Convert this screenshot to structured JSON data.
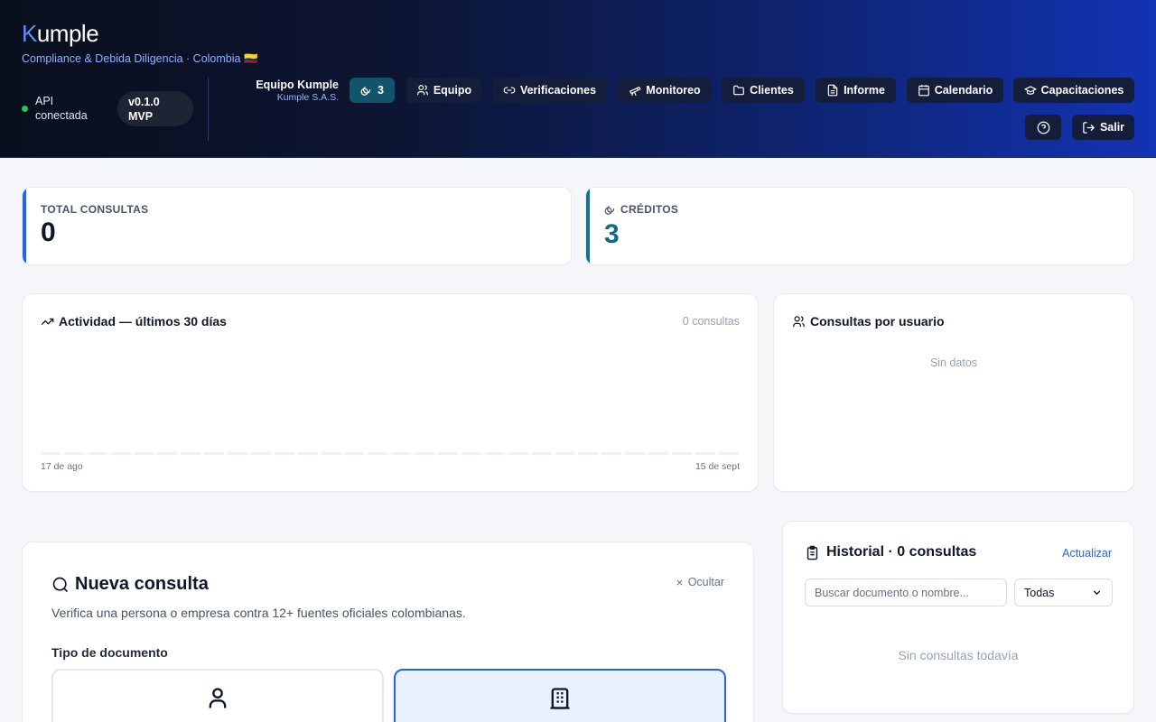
{
  "header": {
    "logo_k": "K",
    "logo_rest": "umple",
    "tagline": "Compliance & Debida Diligencia · Colombia 🇨🇴",
    "api_status": "API conectada",
    "version": "v0.1.0 MVP",
    "team_name": "Equipo Kumple",
    "team_org": "Kumple S.A.S.",
    "credits_count": "3",
    "nav": {
      "equipo": "Equipo",
      "verificaciones": "Verificaciones",
      "monitoreo": "Monitoreo",
      "clientes": "Clientes",
      "informe": "Informe",
      "calendario": "Calendario",
      "capacitaciones": "Capacitaciones"
    },
    "logout_label": "Salir"
  },
  "stats": {
    "total_label": "TOTAL CONSULTAS",
    "total_value": "0",
    "credits_label": "CRÉDITOS",
    "credits_value": "3"
  },
  "activity": {
    "title": "Actividad — últimos 30 días",
    "count": "0 consultas",
    "start_label": "17 de ago",
    "end_label": "15 de sept"
  },
  "chart_data": {
    "type": "bar",
    "x_range": [
      "17 de ago",
      "15 de sept"
    ],
    "values": [
      0,
      0,
      0,
      0,
      0,
      0,
      0,
      0,
      0,
      0,
      0,
      0,
      0,
      0,
      0,
      0,
      0,
      0,
      0,
      0,
      0,
      0,
      0,
      0,
      0,
      0,
      0,
      0,
      0,
      0
    ],
    "title": "Actividad — últimos 30 días"
  },
  "per_user": {
    "title": "Consultas por usuario",
    "empty": "Sin datos"
  },
  "nueva_consulta": {
    "title": "Nueva consulta",
    "hide_label": "Ocultar",
    "description": "Verifica una persona o empresa contra 12+ fuentes oficiales colombianas.",
    "doc_type_label": "Tipo de documento"
  },
  "historial": {
    "title": "Historial · 0 consultas",
    "refresh_label": "Actualizar",
    "search_placeholder": "Buscar documento o nombre...",
    "filter_value": "Todas",
    "empty": "Sin consultas todavía"
  },
  "colors": {
    "accent": "#2563eb",
    "credits_accent": "#0e7490",
    "status_ok": "#22c55e"
  }
}
